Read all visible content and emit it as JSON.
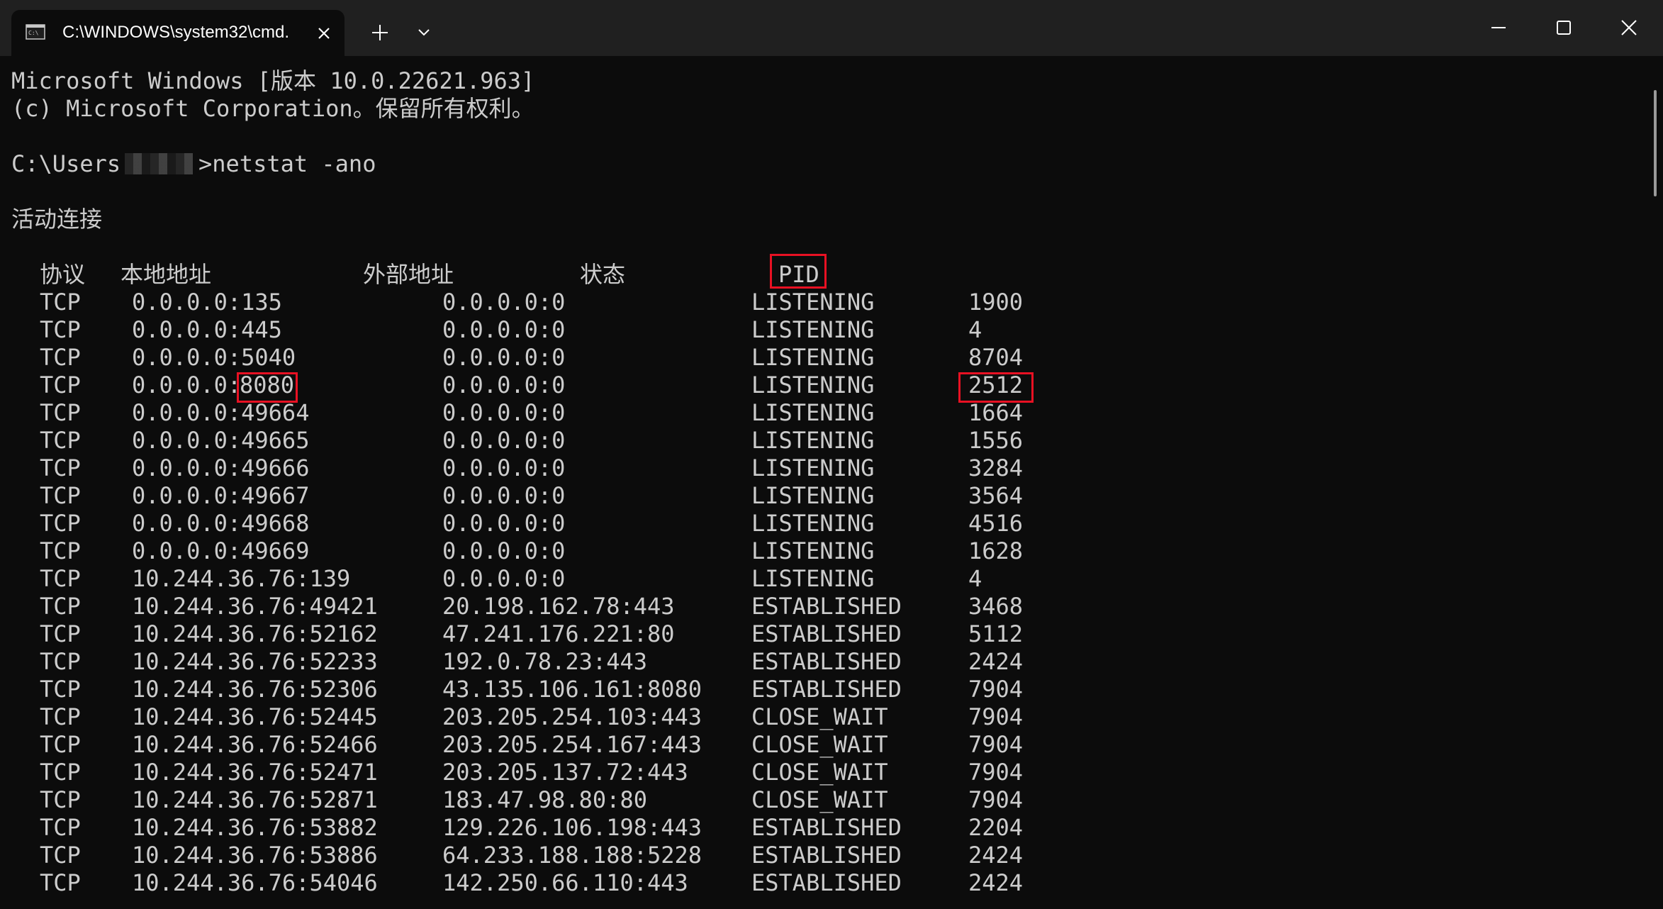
{
  "window": {
    "tab_title": "C:\\WINDOWS\\system32\\cmd.",
    "tab_icon": "cmd-icon"
  },
  "terminal": {
    "banner_line1": "Microsoft Windows [版本 10.0.22621.963]",
    "banner_line2": "(c) Microsoft Corporation。保留所有权利。",
    "prompt_prefix": "C:\\Users",
    "prompt_command": ">netstat -ano",
    "section_title": "活动连接",
    "headers": {
      "protocol": "协议",
      "local_address": "本地地址",
      "foreign_address": "外部地址",
      "state": "状态",
      "pid": "PID"
    },
    "rows": [
      {
        "proto": "TCP",
        "local": "0.0.0.0:135",
        "foreign": "0.0.0.0:0",
        "state": "LISTENING",
        "pid": "1900"
      },
      {
        "proto": "TCP",
        "local": "0.0.0.0:445",
        "foreign": "0.0.0.0:0",
        "state": "LISTENING",
        "pid": "4"
      },
      {
        "proto": "TCP",
        "local": "0.0.0.0:5040",
        "foreign": "0.0.0.0:0",
        "state": "LISTENING",
        "pid": "8704"
      },
      {
        "proto": "TCP",
        "local_ip": "0.0.0.0:",
        "local_port": "8080",
        "foreign": "0.0.0.0:0",
        "state": "LISTENING",
        "pid": "2512"
      },
      {
        "proto": "TCP",
        "local": "0.0.0.0:49664",
        "foreign": "0.0.0.0:0",
        "state": "LISTENING",
        "pid": "1664"
      },
      {
        "proto": "TCP",
        "local": "0.0.0.0:49665",
        "foreign": "0.0.0.0:0",
        "state": "LISTENING",
        "pid": "1556"
      },
      {
        "proto": "TCP",
        "local": "0.0.0.0:49666",
        "foreign": "0.0.0.0:0",
        "state": "LISTENING",
        "pid": "3284"
      },
      {
        "proto": "TCP",
        "local": "0.0.0.0:49667",
        "foreign": "0.0.0.0:0",
        "state": "LISTENING",
        "pid": "3564"
      },
      {
        "proto": "TCP",
        "local": "0.0.0.0:49668",
        "foreign": "0.0.0.0:0",
        "state": "LISTENING",
        "pid": "4516"
      },
      {
        "proto": "TCP",
        "local": "0.0.0.0:49669",
        "foreign": "0.0.0.0:0",
        "state": "LISTENING",
        "pid": "1628"
      },
      {
        "proto": "TCP",
        "local": "10.244.36.76:139",
        "foreign": "0.0.0.0:0",
        "state": "LISTENING",
        "pid": "4"
      },
      {
        "proto": "TCP",
        "local": "10.244.36.76:49421",
        "foreign": "20.198.162.78:443",
        "state": "ESTABLISHED",
        "pid": "3468"
      },
      {
        "proto": "TCP",
        "local": "10.244.36.76:52162",
        "foreign": "47.241.176.221:80",
        "state": "ESTABLISHED",
        "pid": "5112"
      },
      {
        "proto": "TCP",
        "local": "10.244.36.76:52233",
        "foreign": "192.0.78.23:443",
        "state": "ESTABLISHED",
        "pid": "2424"
      },
      {
        "proto": "TCP",
        "local": "10.244.36.76:52306",
        "foreign": "43.135.106.161:8080",
        "state": "ESTABLISHED",
        "pid": "7904"
      },
      {
        "proto": "TCP",
        "local": "10.244.36.76:52445",
        "foreign": "203.205.254.103:443",
        "state": "CLOSE_WAIT",
        "pid": "7904"
      },
      {
        "proto": "TCP",
        "local": "10.244.36.76:52466",
        "foreign": "203.205.254.167:443",
        "state": "CLOSE_WAIT",
        "pid": "7904"
      },
      {
        "proto": "TCP",
        "local": "10.244.36.76:52471",
        "foreign": "203.205.137.72:443",
        "state": "CLOSE_WAIT",
        "pid": "7904"
      },
      {
        "proto": "TCP",
        "local": "10.244.36.76:52871",
        "foreign": "183.47.98.80:80",
        "state": "CLOSE_WAIT",
        "pid": "7904"
      },
      {
        "proto": "TCP",
        "local": "10.244.36.76:53882",
        "foreign": "129.226.106.198:443",
        "state": "ESTABLISHED",
        "pid": "2204"
      },
      {
        "proto": "TCP",
        "local": "10.244.36.76:53886",
        "foreign": "64.233.188.188:5228",
        "state": "ESTABLISHED",
        "pid": "2424"
      },
      {
        "proto": "TCP",
        "local": "10.244.36.76:54046",
        "foreign": "142.250.66.110:443",
        "state": "ESTABLISHED",
        "pid": "2424"
      }
    ]
  },
  "colors": {
    "background": "#0c0c0c",
    "titlebar": "#202020",
    "text": "#cccccc",
    "highlight_box": "#e81123"
  }
}
